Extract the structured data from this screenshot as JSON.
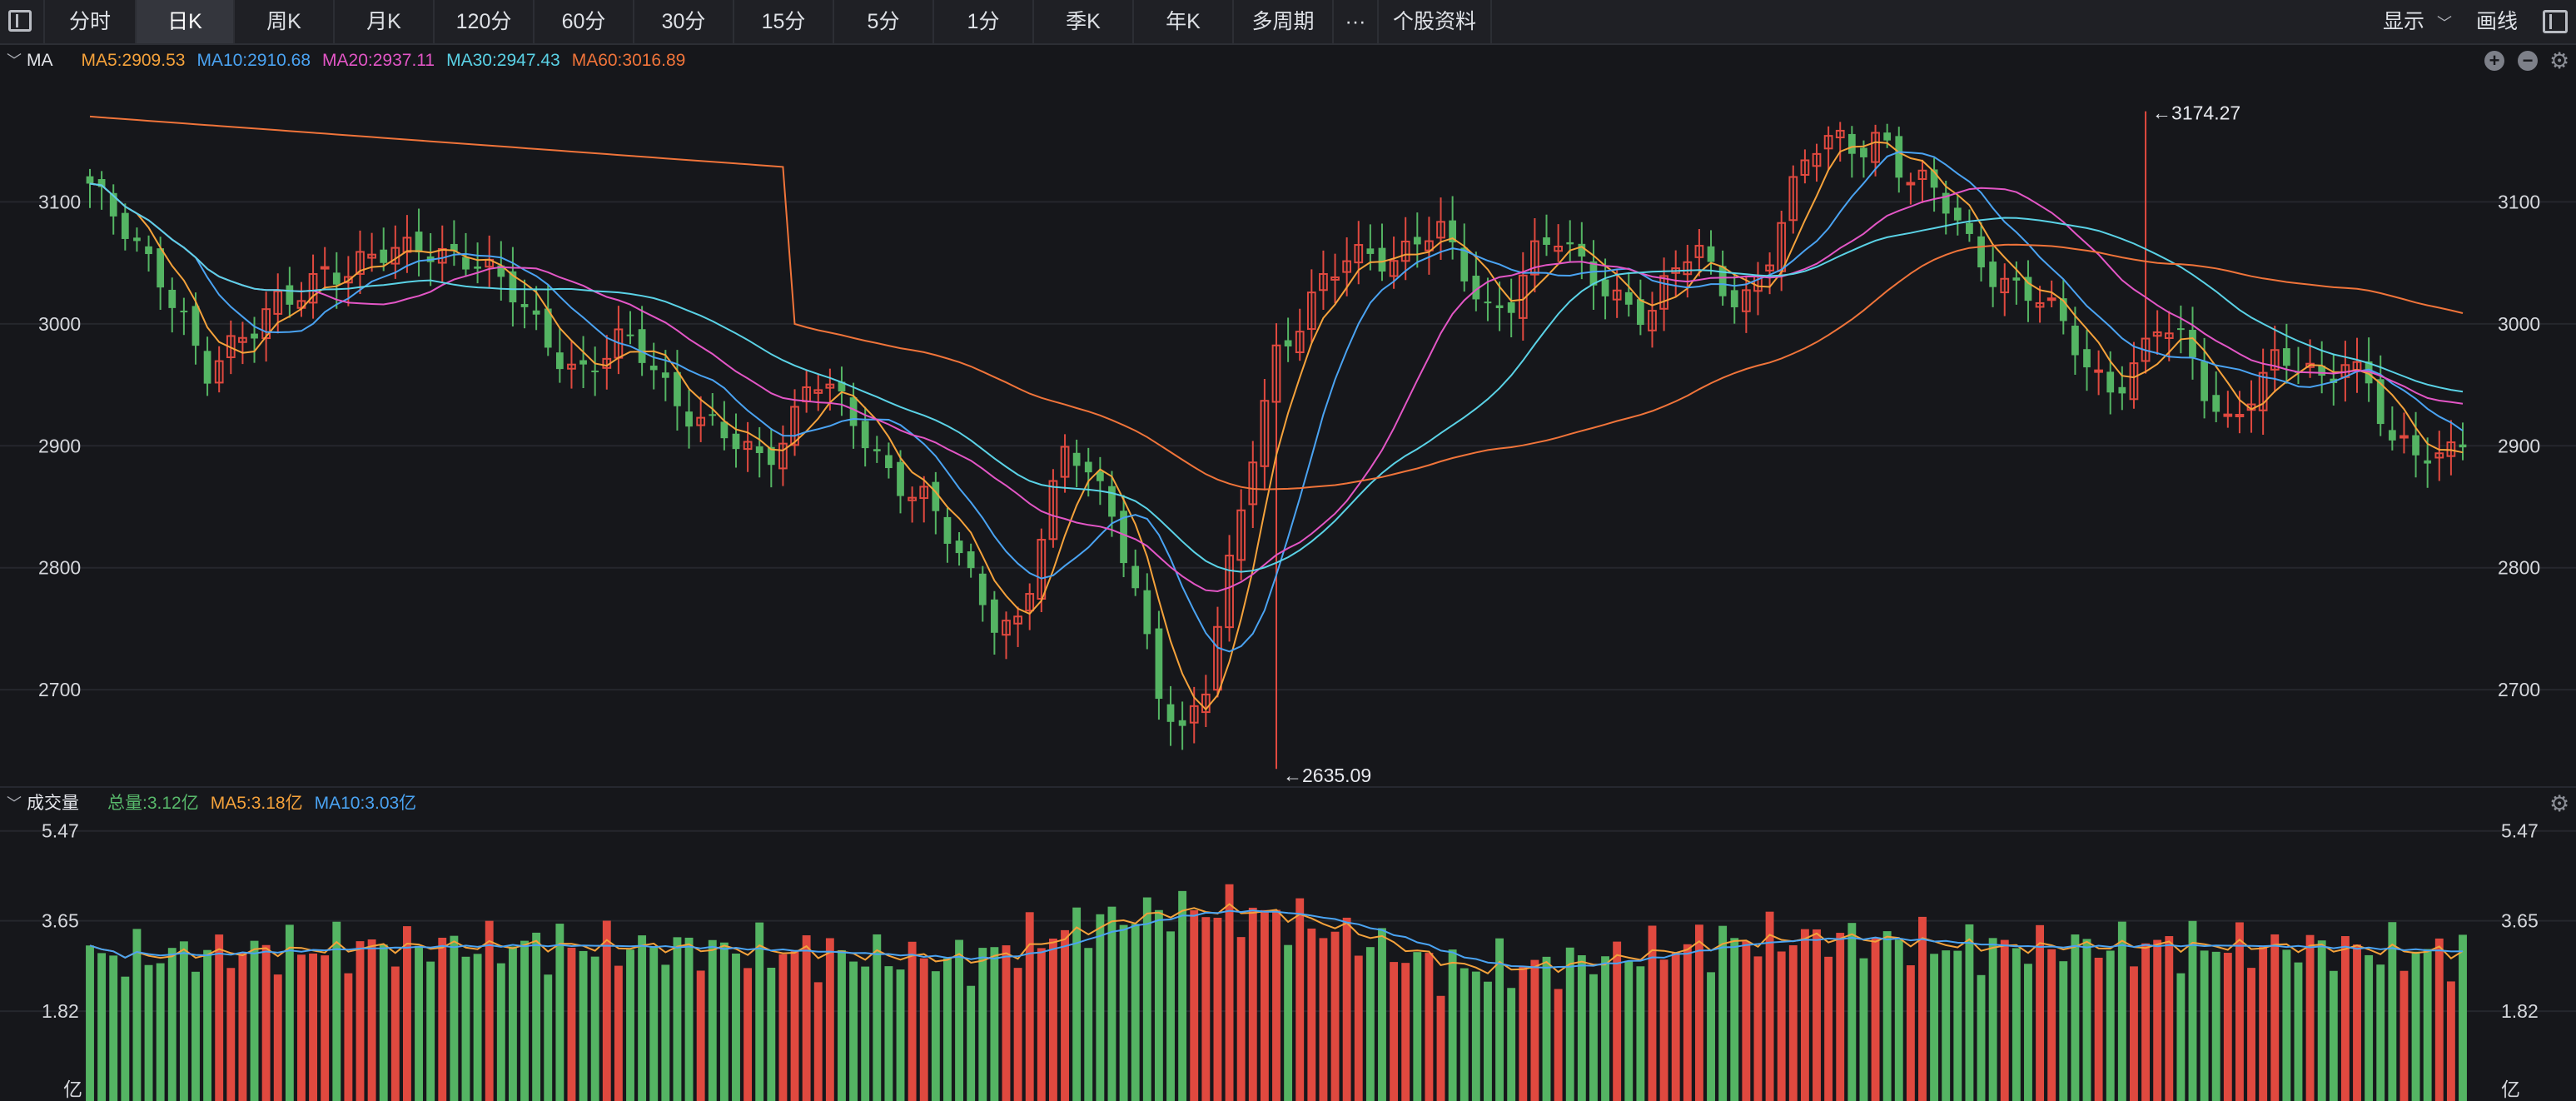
{
  "toolbar": {
    "tabs": [
      {
        "label": "分时",
        "active": false
      },
      {
        "label": "日K",
        "active": true
      },
      {
        "label": "周K",
        "active": false
      },
      {
        "label": "月K",
        "active": false
      },
      {
        "label": "120分",
        "active": false
      },
      {
        "label": "60分",
        "active": false
      },
      {
        "label": "30分",
        "active": false
      },
      {
        "label": "15分",
        "active": false
      },
      {
        "label": "5分",
        "active": false
      },
      {
        "label": "1分",
        "active": false
      },
      {
        "label": "季K",
        "active": false
      },
      {
        "label": "年K",
        "active": false
      },
      {
        "label": "多周期",
        "active": false
      },
      {
        "label": "···",
        "active": false
      },
      {
        "label": "个股资料",
        "active": false
      }
    ],
    "display_label": "显示",
    "draw_label": "画线"
  },
  "icons": {
    "layout": "layout-toggle-icon",
    "panel": "panel-toggle-icon",
    "zoom_in": "zoom-in-icon",
    "zoom_out": "zoom-out-icon",
    "settings": "gear-icon",
    "collapse": "chevron-down-icon"
  },
  "price_legend": {
    "title": "MA",
    "items": [
      {
        "text": "MA5:2909.53",
        "color": "#f5a23b"
      },
      {
        "text": "MA10:2910.68",
        "color": "#4aa3f2"
      },
      {
        "text": "MA20:2937.11",
        "color": "#e356c6"
      },
      {
        "text": "MA30:2947.43",
        "color": "#5ad2e6"
      },
      {
        "text": "MA60:3016.89",
        "color": "#f0743a"
      }
    ]
  },
  "volume_legend": {
    "title": "成交量",
    "items": [
      {
        "text": "总量:3.12亿",
        "color": "#58b96b"
      },
      {
        "text": "MA5:3.18亿",
        "color": "#f5a23b"
      },
      {
        "text": "MA10:3.03亿",
        "color": "#4aa3f2"
      }
    ]
  },
  "colors": {
    "up": "#e0493f",
    "down": "#54b463",
    "grid": "#25272d",
    "bg": "#16171b"
  },
  "chart_data": [
    {
      "type": "candlestick",
      "title": "MA",
      "y_ticks": [
        2700,
        2800,
        2900,
        3000,
        3100
      ],
      "ylim": [
        2625,
        3200
      ],
      "high_marker": {
        "label": "←3174.27",
        "value": 3174.27,
        "index": 175
      },
      "low_marker": {
        "label": "←2635.09",
        "value": 2635.09,
        "index": 101
      },
      "series_keys": {
        "MA5": 0,
        "MA10": 1,
        "MA20": 2,
        "MA30": 3,
        "MA60": 4
      },
      "key_closes": [
        3115,
        3085,
        3060,
        3040,
        3010,
        2960,
        2975,
        2990,
        3020,
        3030,
        3045,
        3035,
        3050,
        3060,
        3070,
        3060,
        3050,
        3040,
        3030,
        3010,
        2980,
        2955,
        2965,
        2990,
        2975,
        2945,
        2920,
        2910,
        2895,
        2890,
        2915,
        2960,
        2940,
        2910,
        2885,
        2870,
        2860,
        2820,
        2780,
        2750,
        2760,
        2840,
        2900,
        2870,
        2840,
        2780,
        2700,
        2660,
        2700,
        2800,
        2900,
        2980,
        3000,
        3030,
        3050,
        3060,
        3055,
        3070,
        3075,
        3040,
        3010,
        3020,
        3060,
        3070,
        3045,
        3030,
        3020,
        3010,
        3040,
        3060,
        3030,
        3020,
        3050,
        3100,
        3140,
        3150,
        3145,
        3160,
        3120,
        3110,
        3090,
        3060,
        3040,
        3030,
        3015,
        2990,
        2960,
        2950,
        2970,
        3000,
        2980,
        2940,
        2920,
        2950,
        2970,
        2960,
        2950,
        2975,
        2955,
        2900,
        2890,
        2885,
        2910
      ]
    },
    {
      "type": "bar",
      "title": "成交量",
      "y_ticks": [
        1.82,
        3.65,
        5.47
      ],
      "y_tick_labels": [
        "1.82",
        "3.65",
        "5.47"
      ],
      "unit": "亿",
      "ylim": [
        0,
        5.6
      ]
    }
  ]
}
